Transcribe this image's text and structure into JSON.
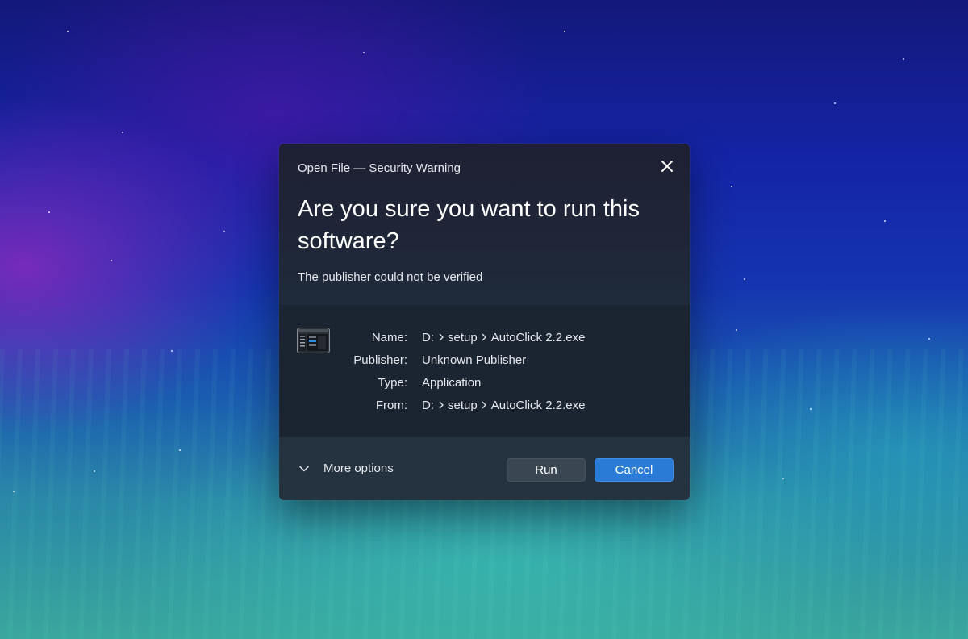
{
  "dialog": {
    "title": "Open File — Security Warning",
    "heading": "Are you sure you want to run this software?",
    "subtext": "The publisher could not be verified",
    "close_icon": "close-icon",
    "file_icon": "application-window-icon"
  },
  "details": {
    "name_label": "Name:",
    "name_path": [
      "D:",
      "setup",
      "AutoClick 2.2.exe"
    ],
    "publisher_label": "Publisher:",
    "publisher_value": "Unknown Publisher",
    "type_label": "Type:",
    "type_value": "Application",
    "from_label": "From:",
    "from_path": [
      "D:",
      "setup",
      "AutoClick 2.2.exe"
    ],
    "path_separator_icon": "chevron-right-icon"
  },
  "footer": {
    "more_options_label": "More options",
    "more_options_icon": "chevron-down-icon",
    "run_label": "Run",
    "cancel_label": "Cancel"
  },
  "colors": {
    "accent": "#2a7bd6",
    "dialog_top": "#1f2638",
    "dialog_mid": "#1b2531",
    "dialog_bottom": "#253240"
  }
}
